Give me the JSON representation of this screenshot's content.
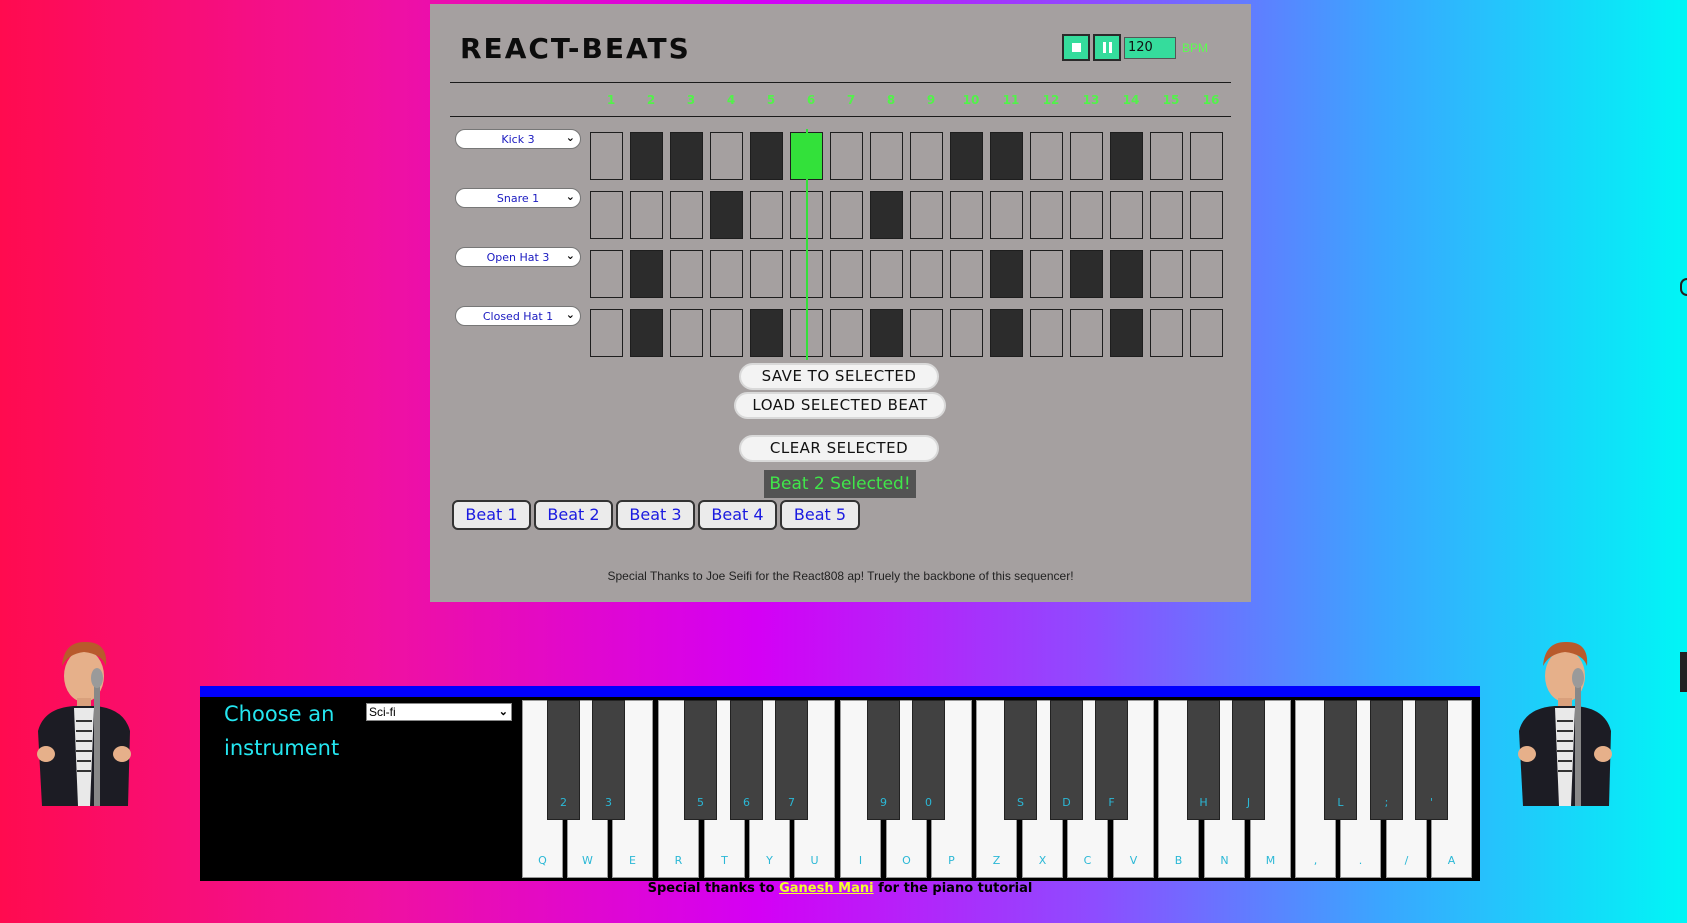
{
  "app_title": "REACT-BEATS",
  "transport": {
    "stop_icon": "stop-icon",
    "pause_icon": "pause-icon",
    "bpm_value": "120",
    "bpm_label": "BPM"
  },
  "steps": [
    "1",
    "2",
    "3",
    "4",
    "5",
    "6",
    "7",
    "8",
    "9",
    "10",
    "11",
    "12",
    "13",
    "14",
    "15",
    "16"
  ],
  "current_step": 6,
  "tracks": [
    {
      "instrument": "Kick 3",
      "pattern": [
        0,
        1,
        1,
        0,
        1,
        0,
        0,
        0,
        0,
        1,
        1,
        0,
        0,
        1,
        0,
        0
      ]
    },
    {
      "instrument": "Snare 1",
      "pattern": [
        0,
        0,
        0,
        1,
        0,
        0,
        0,
        1,
        0,
        0,
        0,
        0,
        0,
        0,
        0,
        0
      ]
    },
    {
      "instrument": "Open Hat 3",
      "pattern": [
        0,
        1,
        0,
        0,
        0,
        0,
        0,
        0,
        0,
        0,
        1,
        0,
        1,
        1,
        0,
        0
      ]
    },
    {
      "instrument": "Closed Hat 1",
      "pattern": [
        0,
        1,
        0,
        0,
        1,
        0,
        0,
        1,
        0,
        0,
        1,
        0,
        0,
        1,
        0,
        0
      ]
    }
  ],
  "actions": {
    "save": "SAVE TO SELECTED",
    "load": "LOAD SELECTED BEAT",
    "clear": "CLEAR SELECTED"
  },
  "selected_status": "Beat 2 Selected!",
  "beats": [
    "Beat 1",
    "Beat 2",
    "Beat 3",
    "Beat 4",
    "Beat 5"
  ],
  "beats_thanks": "Special Thanks to Joe Seifi for the React808 ap! Truely the backbone of this sequencer!",
  "piano": {
    "choose_label": "Choose an instrument",
    "instrument_value": "Sci-fi",
    "white_keys": [
      "Q",
      "W",
      "E",
      "R",
      "T",
      "Y",
      "U",
      "I",
      "O",
      "P",
      "Z",
      "X",
      "C",
      "V",
      "B",
      "N",
      "M",
      ",",
      ".",
      "/",
      "A"
    ],
    "black_keys": [
      "2",
      "3",
      "5",
      "6",
      "7",
      "9",
      "0",
      "S",
      "D",
      "F",
      "H",
      "J",
      "L",
      ";",
      "'"
    ]
  },
  "piano_thanks": {
    "prefix": "Special thanks to",
    "link": "Ganesh Mani",
    "suffix": "for the piano tutorial"
  },
  "colors": {
    "accent_green": "#33e13a",
    "transport_teal": "#35dc9c",
    "beat_blue": "#1a1ae0",
    "piano_bar_blue": "#0000ff"
  }
}
